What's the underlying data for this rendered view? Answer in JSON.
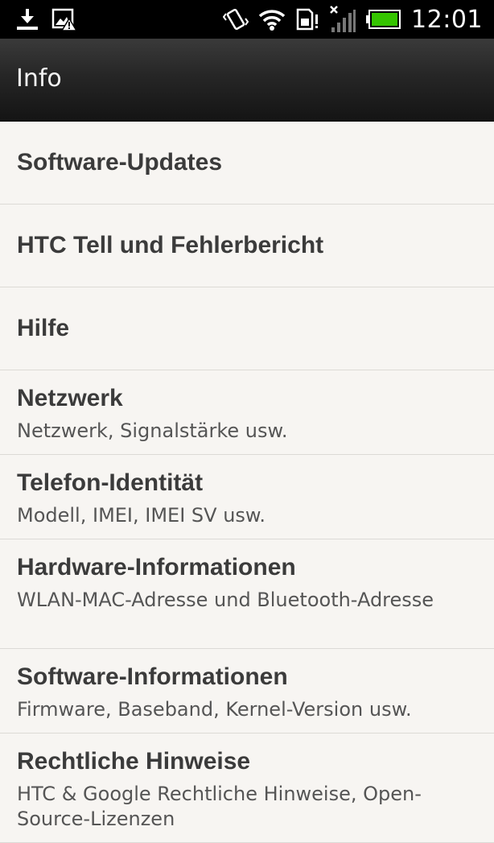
{
  "status_bar": {
    "time": "12:01",
    "icons": [
      "download-icon",
      "image-warning-icon",
      "vibrate-icon",
      "wifi-icon",
      "sim-warning-icon",
      "signal-no-service-icon",
      "battery-icon"
    ],
    "battery_color": "#35c400"
  },
  "header": {
    "title": "Info"
  },
  "items": [
    {
      "label": "Software-Updates"
    },
    {
      "label": "HTC Tell und Fehlerbericht"
    },
    {
      "label": "Hilfe"
    },
    {
      "label": "Netzwerk",
      "sub": "Netzwerk, Signalstärke usw."
    },
    {
      "label": "Telefon-Identität",
      "sub": "Modell, IMEI, IMEI SV usw."
    },
    {
      "label": "Hardware-Informationen",
      "sub": "WLAN-MAC-Adresse und Bluetooth-Adresse"
    },
    {
      "label": "Software-Informationen",
      "sub": "Firmware, Baseband, Kernel-Version usw."
    },
    {
      "label": "Rechtliche Hinweise",
      "sub": "HTC & Google Rechtliche Hinweise, Open-Source-Lizenzen"
    }
  ]
}
